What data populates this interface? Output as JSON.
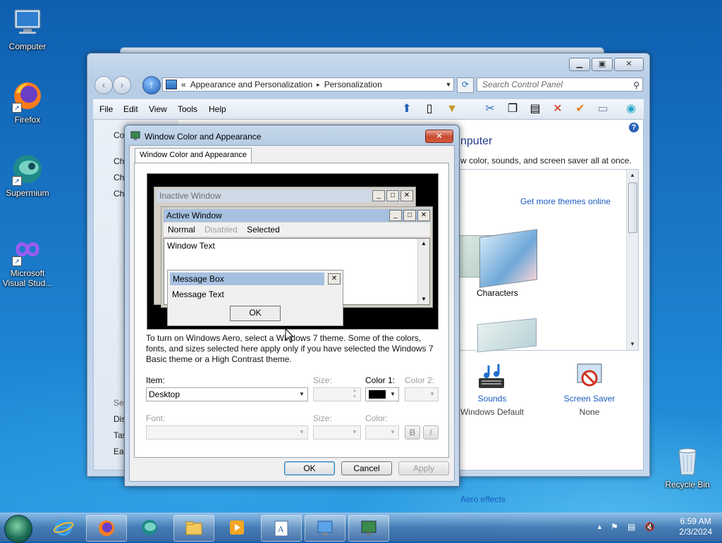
{
  "desktop": {
    "icons": [
      {
        "label": "Computer"
      },
      {
        "label": "Firefox"
      },
      {
        "label": "Supermium"
      },
      {
        "label": "Microsoft Visual Stud..."
      },
      {
        "label": "Recycle Bin"
      }
    ]
  },
  "control_panel": {
    "breadcrumb": {
      "prefix": "«",
      "items": [
        "Appearance and Personalization",
        "Personalization"
      ],
      "separator": "▸"
    },
    "search_placeholder": "Search Control Panel",
    "menu": [
      "File",
      "Edit",
      "View",
      "Tools",
      "Help"
    ],
    "sidebar": {
      "items": [
        "Co",
        "Ch",
        "Ch",
        "Ch"
      ],
      "see_also_items": [
        "See",
        "Dis",
        "Tas",
        "Eas"
      ]
    },
    "title": "nputer",
    "description": "w color, sounds, and screen saver all at once.",
    "themes": {
      "get_more_link": "Get more themes online",
      "characters_label": "Characters"
    },
    "bottom": {
      "sounds": {
        "label": "Sounds",
        "sub": "Windows Default"
      },
      "screen_saver": {
        "label": "Screen Saver",
        "sub": "None"
      },
      "aero_link": "Aero effects"
    }
  },
  "dialog": {
    "title": "Window Color and Appearance",
    "tab": "Window Color and Appearance",
    "preview": {
      "inactive_title": "Inactive Window",
      "active_title": "Active Window",
      "menu_normal": "Normal",
      "menu_disabled": "Disabled",
      "menu_selected": "Selected",
      "window_text": "Window Text",
      "message_box_title": "Message Box",
      "message_text": "Message Text",
      "ok": "OK"
    },
    "help_text": "To turn on Windows Aero, select a Windows 7 theme.  Some of the colors, fonts, and sizes selected here apply only if you have selected the Windows 7 Basic theme or a High Contrast theme.",
    "item_label": "Item:",
    "item_value": "Desktop",
    "size_label": "Size:",
    "color1_label": "Color 1:",
    "color1_value": "#000000",
    "color2_label": "Color 2:",
    "font_label": "Font:",
    "font_size_label": "Size:",
    "color_label": "Color:",
    "bold": "B",
    "italic": "I",
    "ok": "OK",
    "cancel": "Cancel",
    "apply": "Apply"
  },
  "taskbar": {
    "time": "6:59 AM",
    "date": "2/3/2024"
  },
  "colors": {
    "accent_link": "#1a5bbf",
    "close_button": "#c84a31",
    "active_caption": "#a6c0e0",
    "inactive_caption": "#cfd9e6"
  }
}
